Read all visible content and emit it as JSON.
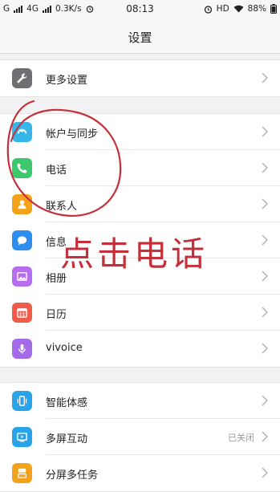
{
  "status_bar": {
    "left_text": "G ull 4G ull 0.3K/s",
    "time": "08:13",
    "hd": "HD",
    "battery": "88%"
  },
  "header": {
    "title": "设置"
  },
  "sections": [
    {
      "items": [
        {
          "label": "更多设置",
          "icon": "wrench-icon",
          "color": "#6e7073"
        }
      ]
    },
    {
      "items": [
        {
          "label": "帐户与同步",
          "icon": "sync-icon",
          "color": "#35b5e8"
        },
        {
          "label": "电话",
          "icon": "phone-icon",
          "color": "#3dc86d"
        },
        {
          "label": "联系人",
          "icon": "contact-icon",
          "color": "#f4a21a"
        },
        {
          "label": "信息",
          "icon": "message-icon",
          "color": "#2d8ef0"
        },
        {
          "label": "相册",
          "icon": "album-icon",
          "color": "#b56ef0"
        },
        {
          "label": "日历",
          "icon": "calendar-icon",
          "color": "#f05b4a"
        },
        {
          "label": "vivoice",
          "icon": "microphone-icon",
          "color": "#a56ae8"
        }
      ]
    },
    {
      "items": [
        {
          "label": "智能体感",
          "icon": "motion-icon",
          "color": "#2aa3e8"
        },
        {
          "label": "多屏互动",
          "icon": "screen-icon",
          "color": "#2aa3e8",
          "value": "已关闭"
        },
        {
          "label": "分屏多任务",
          "icon": "split-icon",
          "color": "#f4a21a"
        }
      ]
    }
  ],
  "annotation": {
    "text": "点击电话"
  }
}
